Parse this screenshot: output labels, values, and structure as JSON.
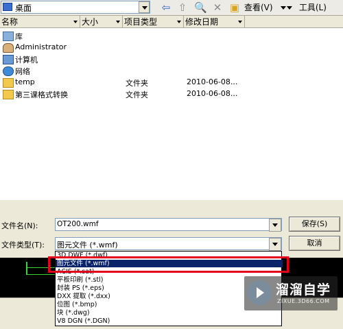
{
  "toolbar": {
    "location": "桌面",
    "view_label": "查看(V)",
    "tools_label": "工具(L)"
  },
  "file_list": {
    "columns": [
      "名称",
      "大小",
      "项目类型",
      "修改日期"
    ],
    "rows": [
      {
        "name": "库",
        "type": "",
        "date": "",
        "icon": "library-icon"
      },
      {
        "name": "Administrator",
        "type": "",
        "date": "",
        "icon": "user-icon"
      },
      {
        "name": "计算机",
        "type": "",
        "date": "",
        "icon": "computer-icon"
      },
      {
        "name": "网络",
        "type": "",
        "date": "",
        "icon": "network-icon"
      },
      {
        "name": "temp",
        "type": "文件夹",
        "date": "2010-06-08...",
        "icon": "folder-icon"
      },
      {
        "name": "第三课格式转换",
        "type": "文件夹",
        "date": "2010-06-08...",
        "icon": "folder-icon"
      }
    ]
  },
  "form": {
    "filename_label": "文件名(N):",
    "filename_value": "OT200.wmf",
    "filetype_label": "文件类型(T):",
    "filetype_value": "图元文件 (*.wmf)",
    "save_label": "保存(S)",
    "cancel_label": "取消"
  },
  "dropdown": {
    "options": [
      "3D DWF (*.dwf)",
      "图元文件 (*.wmf)",
      "ACIS (*.sat)",
      "平板印刷 (*.stl)",
      "封装 PS (*.eps)",
      "DXX 提取 (*.dxx)",
      "位图 (*.bmp)",
      "块 (*.dwg)",
      "V8 DGN (*.DGN)"
    ],
    "selected_index": 1
  },
  "watermark": {
    "title": "溜溜自学",
    "url": "ZIXUE.3D66.COM"
  },
  "colors": {
    "selection": "#0a246a",
    "highlight_box": "#e3001b",
    "dialog_bg": "#ece9d8"
  }
}
